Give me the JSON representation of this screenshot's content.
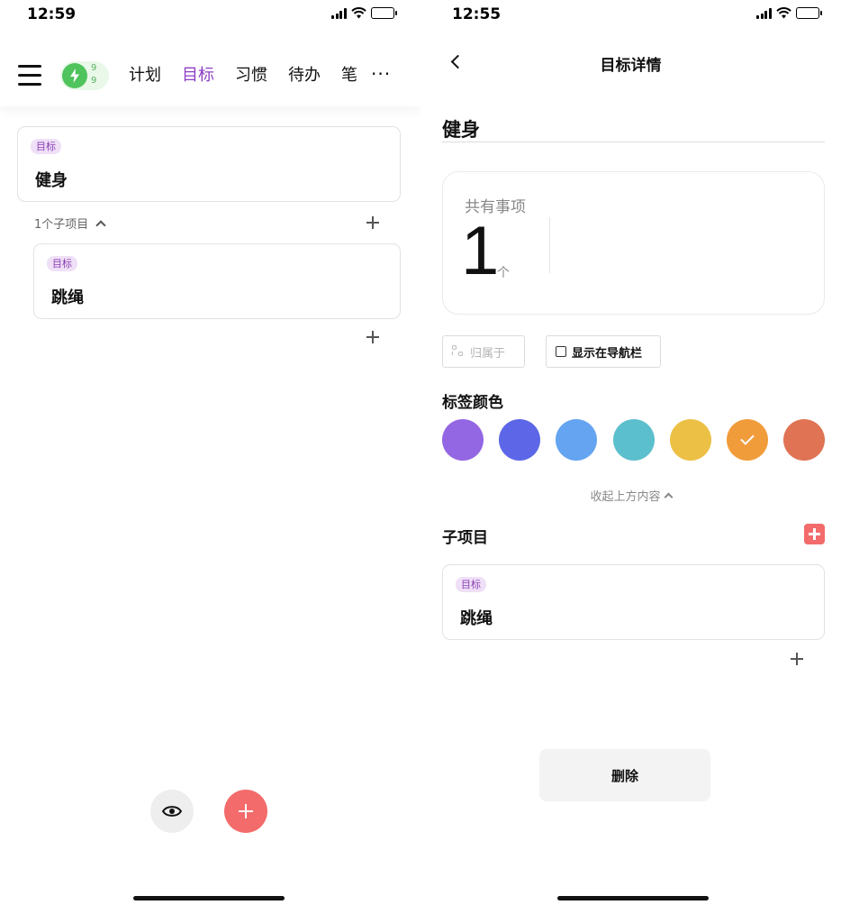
{
  "left": {
    "status_time": "12:59",
    "energy": {
      "top": "9",
      "bottom": "9"
    },
    "tabs": [
      {
        "label": "计划",
        "active": false
      },
      {
        "label": "目标",
        "active": true
      },
      {
        "label": "习惯",
        "active": false
      },
      {
        "label": "待办",
        "active": false
      },
      {
        "label": "笔",
        "active": false
      }
    ],
    "more_label": "···",
    "goal_card": {
      "tag": "目标",
      "title": "健身"
    },
    "subitems_label": "1个子项目",
    "child_card": {
      "tag": "目标",
      "title": "跳绳"
    }
  },
  "right": {
    "status_time": "12:55",
    "page_title": "目标详情",
    "goal_name": "健身",
    "stats": {
      "label": "共有事项",
      "count": "1",
      "unit": "个"
    },
    "belong_label": "归属于",
    "show_nav_label": "显示在导航栏",
    "color_label": "标签颜色",
    "colors": [
      "#9366e3",
      "#5c66e6",
      "#64a4f1",
      "#5bbfcd",
      "#ecc045",
      "#f19c3a",
      "#e07353"
    ],
    "selected_color_index": 5,
    "collapse_label": "收起上方内容",
    "subitems_title": "子项目",
    "child_card": {
      "tag": "目标",
      "title": "跳绳"
    },
    "delete_label": "删除"
  }
}
